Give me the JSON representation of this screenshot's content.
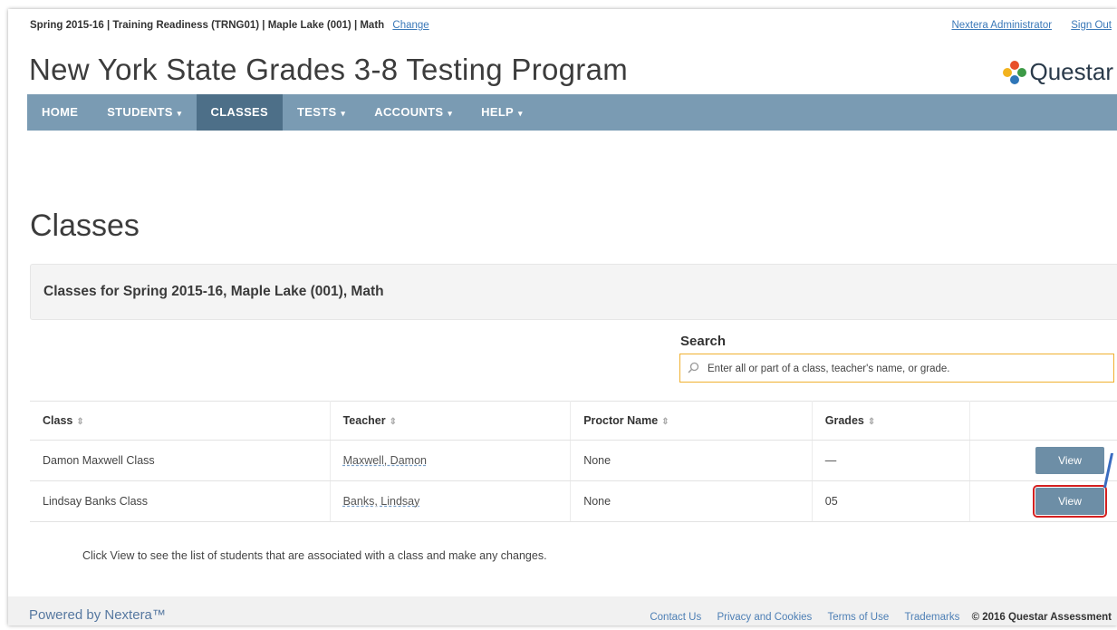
{
  "topbar": {
    "context": "Spring 2015-16  | Training Readiness (TRNG01)  | Maple Lake (001)  | Math",
    "change_link": "Change",
    "user_link": "Nextera Administrator",
    "signout_link": "Sign Out"
  },
  "header": {
    "title": "New York State Grades 3-8 Testing Program",
    "brand": "Questar"
  },
  "nav": {
    "items": [
      {
        "label": "HOME",
        "caret": ""
      },
      {
        "label": "STUDENTS",
        "caret": "▾"
      },
      {
        "label": "CLASSES",
        "caret": ""
      },
      {
        "label": "TESTS",
        "caret": "▾"
      },
      {
        "label": "ACCOUNTS",
        "caret": "▾"
      },
      {
        "label": "HELP",
        "caret": "▾"
      }
    ],
    "active": "CLASSES"
  },
  "page": {
    "title": "Classes",
    "panel_heading": "Classes for Spring 2015-16, Maple Lake (001), Math"
  },
  "search": {
    "label": "Search",
    "placeholder": "Enter all or part of a class, teacher's name, or grade."
  },
  "table": {
    "headers": [
      "Class",
      "Teacher",
      "Proctor Name",
      "Grades"
    ],
    "rows": [
      {
        "class": "Damon Maxwell Class",
        "teacher": "Maxwell, Damon",
        "proctor": "None",
        "grades": "—",
        "action": "View"
      },
      {
        "class": "Lindsay Banks Class",
        "teacher": "Banks, Lindsay",
        "proctor": "None",
        "grades": "05",
        "action": "View"
      }
    ]
  },
  "note": "Click View to see the list of students that are associated with a class and make any changes.",
  "footer": {
    "powered": "Powered by Nextera™",
    "links": [
      "Contact Us",
      "Privacy and Cookies",
      "Terms of Use",
      "Trademarks"
    ],
    "copyright": "© 2016 Questar Assessment"
  },
  "colors": {
    "nav_bg": "#7a9bb3",
    "nav_active": "#4d6f88",
    "button": "#6d8ea6",
    "highlight": "#d42020",
    "search_border": "#f0b030"
  }
}
